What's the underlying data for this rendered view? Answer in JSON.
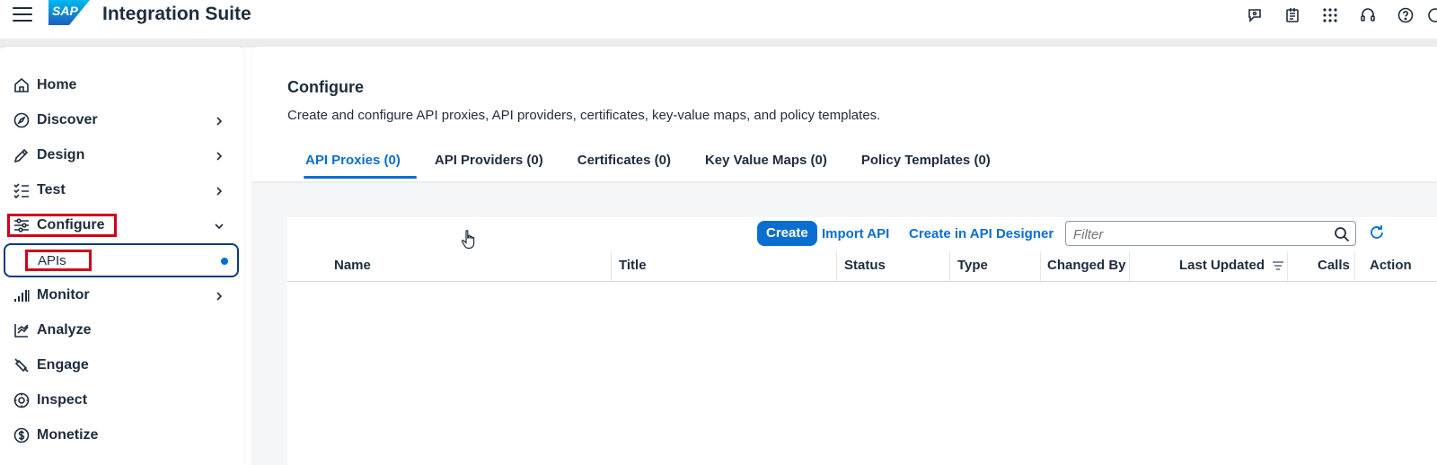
{
  "header": {
    "app_title": "Integration Suite",
    "logo_text": "SAP",
    "icons": [
      "assistant-icon",
      "notes-icon",
      "grid-icon",
      "headset-icon",
      "help-icon"
    ]
  },
  "sidebar": {
    "items": [
      {
        "label": "Home",
        "icon": "home-icon",
        "expandable": false
      },
      {
        "label": "Discover",
        "icon": "compass-icon",
        "expandable": true
      },
      {
        "label": "Design",
        "icon": "pencil-icon",
        "expandable": true
      },
      {
        "label": "Test",
        "icon": "checklist-icon",
        "expandable": true
      },
      {
        "label": "Configure",
        "icon": "configure-icon",
        "expanded": true
      },
      {
        "label": "Monitor",
        "icon": "monitor-icon",
        "expandable": true
      },
      {
        "label": "Analyze",
        "icon": "analyze-icon",
        "expandable": false
      },
      {
        "label": "Engage",
        "icon": "engage-icon",
        "expandable": false
      },
      {
        "label": "Inspect",
        "icon": "inspect-icon",
        "expandable": false
      },
      {
        "label": "Monetize",
        "icon": "dollar-icon",
        "expandable": false
      }
    ],
    "sub_item": {
      "label": "APIs",
      "selected": true
    }
  },
  "main": {
    "title": "Configure",
    "description": "Create and configure API proxies, API providers, certificates, key-value maps, and policy templates.",
    "tabs": [
      {
        "label": "API Proxies (0)",
        "active": true
      },
      {
        "label": "API Providers (0)"
      },
      {
        "label": "Certificates (0)"
      },
      {
        "label": "Key Value Maps (0)"
      },
      {
        "label": "Policy Templates (0)"
      }
    ],
    "toolbar": {
      "create_label": "Create",
      "import_label": "Import API",
      "designer_label": "Create in API Designer",
      "filter_placeholder": "Filter"
    },
    "columns": [
      "Name",
      "Title",
      "Status",
      "Type",
      "Changed By",
      "Last Updated",
      "Calls",
      "Action"
    ]
  },
  "colors": {
    "accent": "#0a6ed1",
    "highlight_box": "#d0021b",
    "selected_border": "#0a3a82"
  }
}
